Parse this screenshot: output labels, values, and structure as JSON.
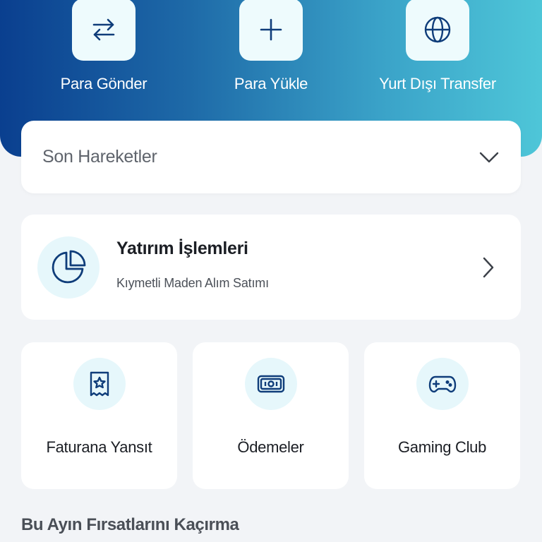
{
  "quick_actions": [
    {
      "label": "Para Gönder",
      "icon": "swap-arrows-icon"
    },
    {
      "label": "Para Yükle",
      "icon": "plus-icon"
    },
    {
      "label": "Yurt Dışı Transfer",
      "icon": "globe-icon"
    }
  ],
  "recent": {
    "title": "Son Hareketler",
    "icon": "chevron-down-icon"
  },
  "investment": {
    "title": "Yatırım İşlemleri",
    "subtitle": "Kıymetli Maden Alım Satımı",
    "icon": "pie-chart-icon"
  },
  "tiles": [
    {
      "label": "Faturana Yansıt",
      "icon": "receipt-star-icon"
    },
    {
      "label": "Ödemeler",
      "icon": "banknote-icon"
    },
    {
      "label": "Gaming Club",
      "icon": "gamepad-icon"
    }
  ],
  "section": {
    "title": "Bu Ayın Fırsatlarını Kaçırma"
  },
  "colors": {
    "brand_dark": "#0a3f8f",
    "brand_light": "#4ec6d8",
    "icon_blue": "#0f3d7a",
    "background": "#f2f4f7"
  }
}
